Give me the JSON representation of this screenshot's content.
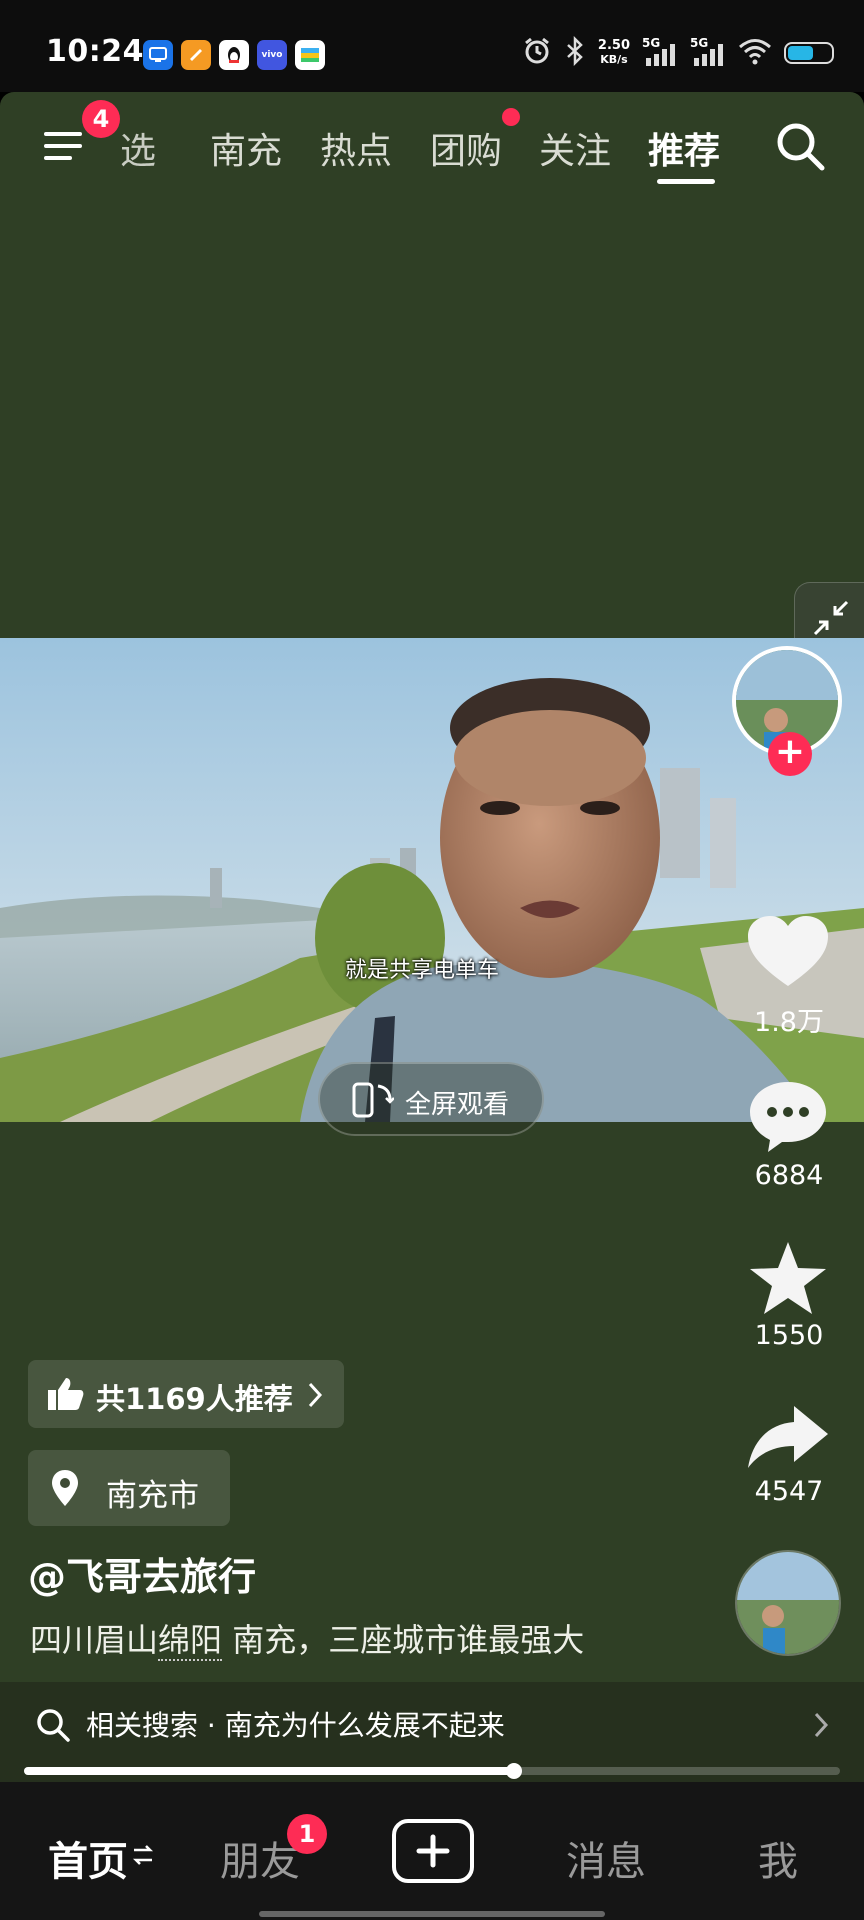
{
  "status_bar": {
    "time": "10:24",
    "net_speed_value": "2.50",
    "net_speed_unit": "KB/s",
    "signal_1": "5G",
    "signal_2": "5G",
    "app_icons": [
      "screen-share-icon",
      "pen-app-icon",
      "qq-penguin-icon",
      "vivo-icon",
      "wallet-card-icon"
    ],
    "battery_level": 0.6
  },
  "top_nav": {
    "menu_badge": "4",
    "tabs": [
      {
        "label": "精选",
        "visible_text": "选"
      },
      {
        "label": "南充"
      },
      {
        "label": "热点"
      },
      {
        "label": "团购"
      },
      {
        "label": "关注"
      },
      {
        "label": "推荐",
        "active": true
      }
    ]
  },
  "video": {
    "subtitle": "就是共享电单车",
    "fullscreen_label": "全屏观看",
    "progress": 0.6
  },
  "actions": {
    "likes": "1.8万",
    "comments": "6884",
    "favorites": "1550",
    "shares": "4547"
  },
  "info": {
    "recommend": "共1169人推荐",
    "location": "南充市",
    "author": "@飞哥去旅行",
    "caption_before": "四川眉山",
    "caption_link": "绵阳",
    "caption_after": " 南充，三座城市谁最强大"
  },
  "related_search": {
    "text": "相关搜索 · 南充为什么发展不起来"
  },
  "bottom_nav": {
    "home": "首页",
    "friends": "朋友",
    "friends_badge": "1",
    "messages": "消息",
    "me": "我"
  },
  "colors": {
    "background": "#2f3f25",
    "accent": "#fe2c55",
    "bottom_bar": "#151515"
  }
}
